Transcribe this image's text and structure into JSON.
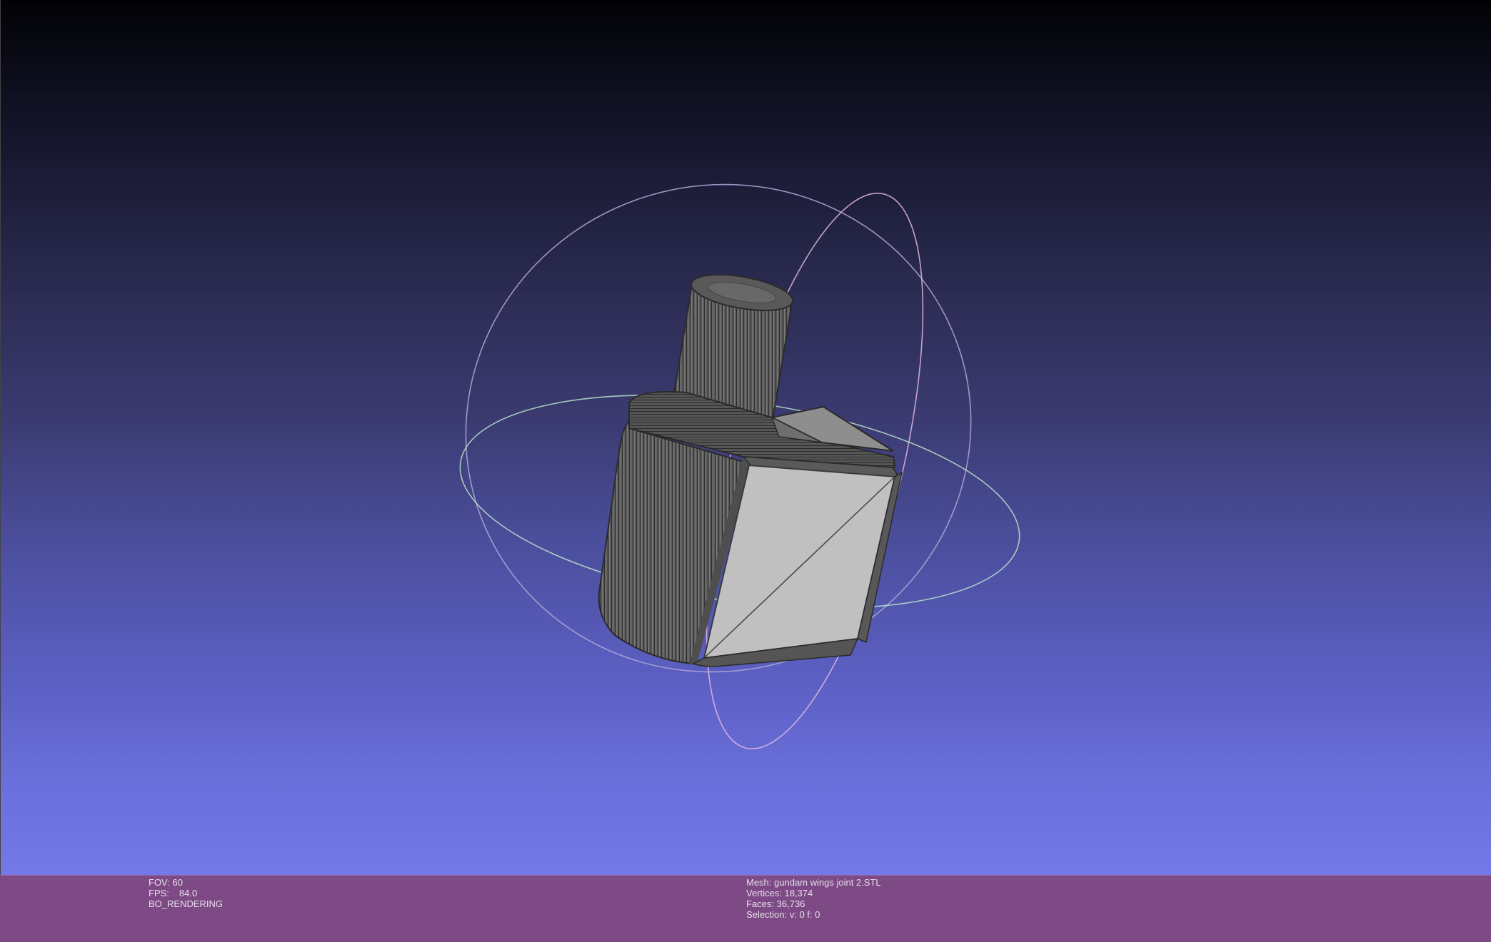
{
  "viewport": {
    "name": "3D mesh viewport",
    "background_top": "#020206",
    "background_bottom": "#7478e8",
    "mesh_fill": "#c0c0c0",
    "mesh_wire": "#3a3a3a"
  },
  "info_left": {
    "fov_label": "FOV:",
    "fov_value": "60",
    "fps_label": "FPS:",
    "fps_value": "84.0",
    "render_mode": "BO_RENDERING"
  },
  "info_right": {
    "mesh_label": "Mesh:",
    "mesh_value": "gundam wings joint 2.STL",
    "vertices_label": "Vertices:",
    "vertices_value": "18,374",
    "faces_label": "Faces:",
    "faces_value": "36,736",
    "selection_label": "Selection:",
    "selection_value": "v: 0 f: 0"
  },
  "infobar_color": "#7e4a86"
}
